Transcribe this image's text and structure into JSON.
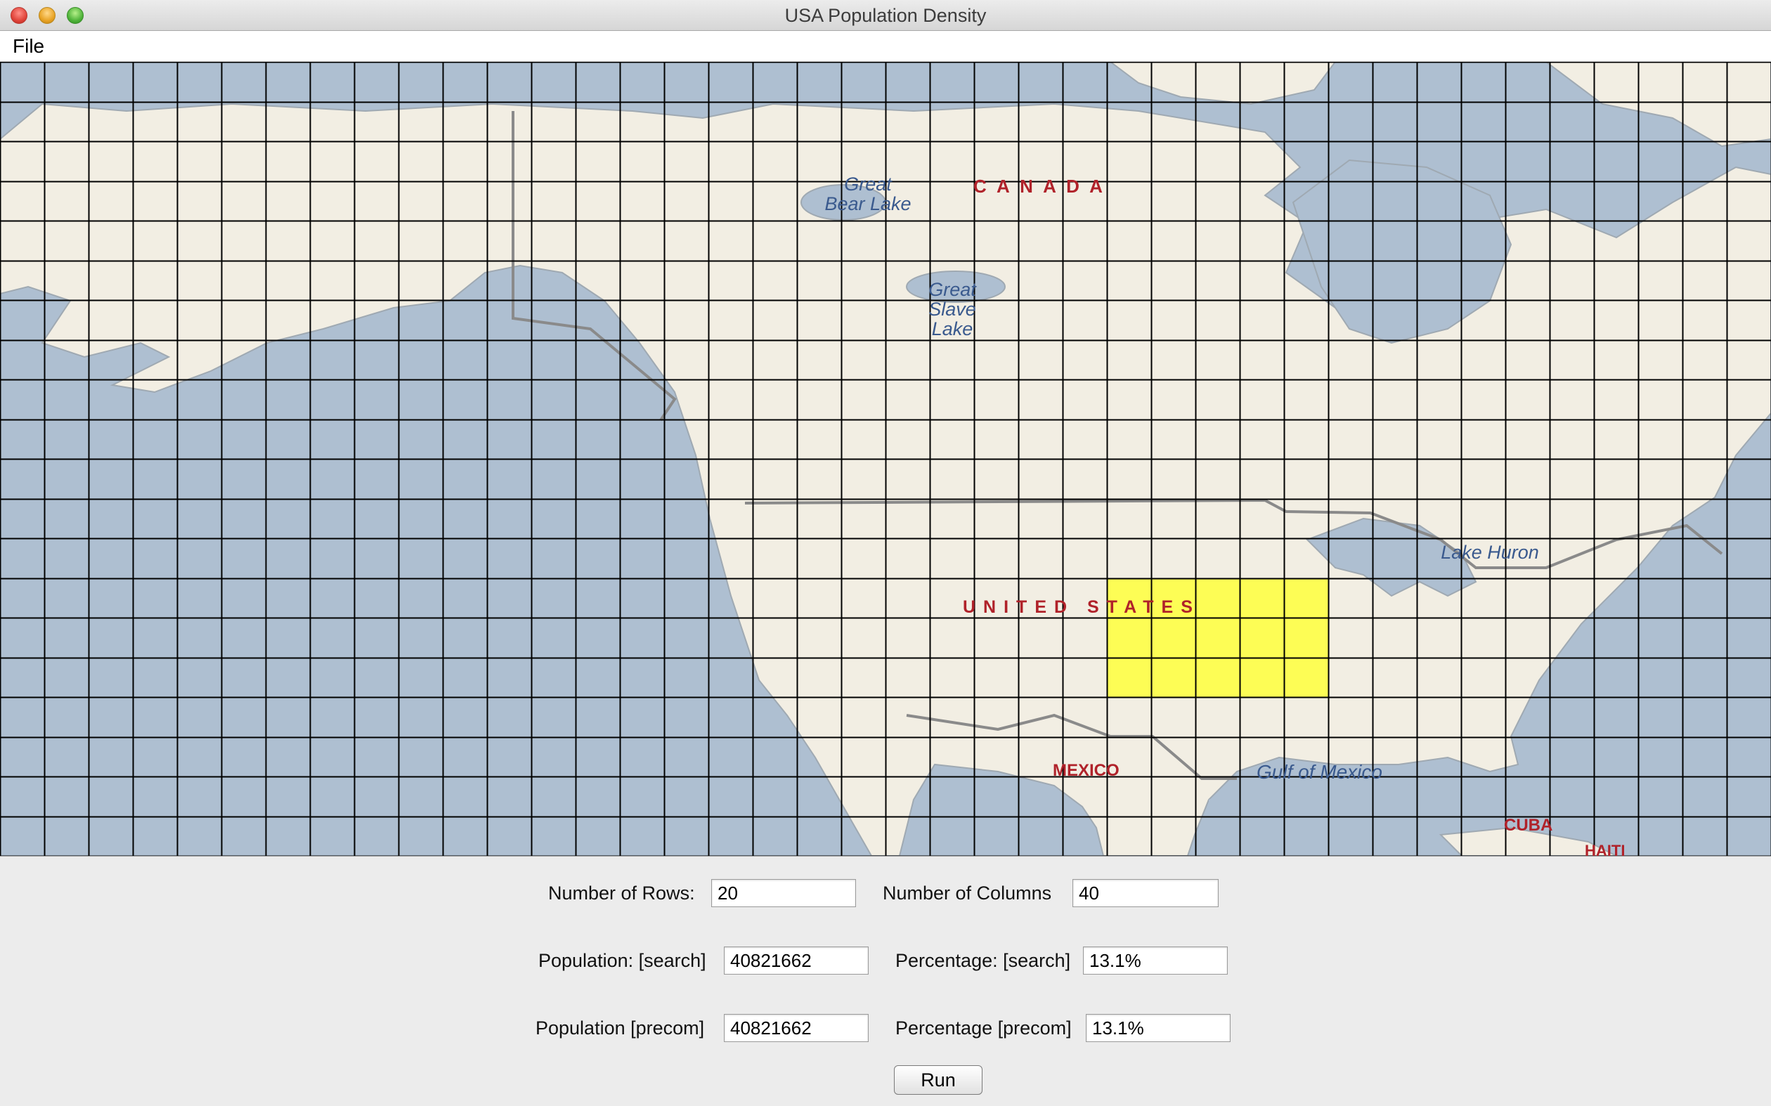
{
  "window": {
    "title": "USA Population Density"
  },
  "menu": {
    "items": [
      "File"
    ]
  },
  "map": {
    "grid": {
      "rows": 20,
      "columns": 40
    },
    "highlight": {
      "row_start": 13,
      "row_end": 16,
      "col_start": 25,
      "col_end": 30,
      "color": "#ffff3c"
    },
    "labels": {
      "canada": "C A N A D A",
      "great_bear_lake": "Great Bear Lake",
      "great_slave_lake": "Great Slave Lake",
      "united_states": "UNITED STATES",
      "lake_huron": "Lake Huron",
      "mexico": "MEXICO",
      "gulf_of_mexico": "Gulf of Mexico",
      "cuba": "CUBA",
      "haiti": "HAITI"
    },
    "colors": {
      "water": "#aebfd1",
      "land": "#f2eee3",
      "grid": "#000000",
      "label_red": "#b0222a",
      "label_blue": "#3a5a8e"
    }
  },
  "form": {
    "rows_label": "Number of Rows:",
    "rows_value": "20",
    "columns_label": "Number of Columns",
    "columns_value": "40",
    "pop_search_label": "Population: [search]",
    "pop_search_value": "40821662",
    "pct_search_label": "Percentage: [search]",
    "pct_search_value": "13.1%",
    "pop_precom_label": "Population [precom]",
    "pop_precom_value": "40821662",
    "pct_precom_label": "Percentage [precom]",
    "pct_precom_value": "13.1%",
    "run_label": "Run"
  }
}
